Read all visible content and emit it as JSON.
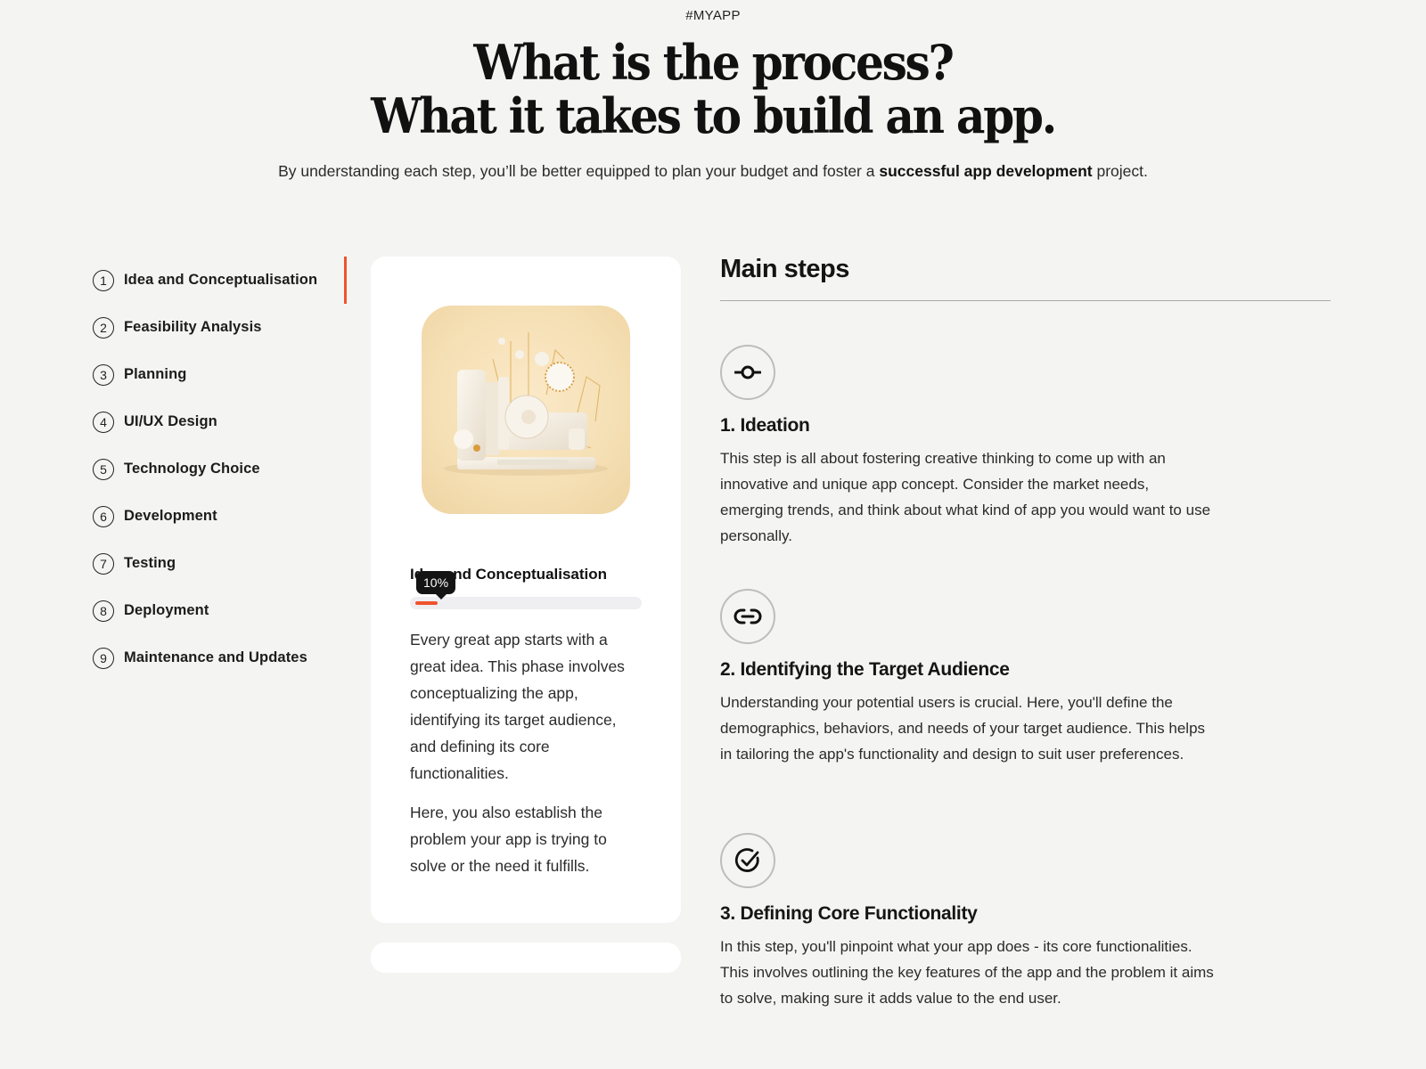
{
  "header": {
    "eyebrow": "#MYAPP",
    "title_line1": "What is the process?",
    "title_line2": "What it takes to build an app.",
    "subtitle_pre": "By understanding each step, you’ll be better equipped to plan your budget and foster a ",
    "subtitle_bold": "successful app development",
    "subtitle_post": " project."
  },
  "sidebar": {
    "active_index": 0,
    "accent_color": "#f0532d",
    "items": [
      {
        "num": "1",
        "label": "Idea and Conceptualisation"
      },
      {
        "num": "2",
        "label": "Feasibility Analysis"
      },
      {
        "num": "3",
        "label": "Planning"
      },
      {
        "num": "4",
        "label": "UI/UX Design"
      },
      {
        "num": "5",
        "label": "Technology Choice"
      },
      {
        "num": "6",
        "label": "Development"
      },
      {
        "num": "7",
        "label": "Testing"
      },
      {
        "num": "8",
        "label": "Deployment"
      },
      {
        "num": "9",
        "label": "Maintenance and Updates"
      }
    ]
  },
  "card": {
    "image_alt": "3D illustration of a retro computer with abstract shapes",
    "title": "Idea and Conceptualisation",
    "progress_percent": 10,
    "progress_label": "10%",
    "paragraph1": "Every great app starts with a great idea. This phase involves conceptualizing the app, identifying its target audience, and defining its core functionalities.",
    "paragraph2": "Here, you also establish the problem your app is trying to solve or the need it fulfills."
  },
  "main": {
    "heading": "Main steps",
    "steps": [
      {
        "icon": "commit-icon",
        "title": "1. Ideation",
        "description": "This step is all about fostering creative thinking to come up with an innovative and unique app concept. Consider the market needs, emerging trends, and think about what kind of app you would want to use personally."
      },
      {
        "icon": "link-icon",
        "title": "2. Identifying the Target Audience",
        "description": "Understanding your potential users is crucial. Here, you'll define the demographics, behaviors, and needs of your target audience. This helps in tailoring the app's functionality and design to suit user preferences."
      },
      {
        "icon": "check-circle-icon",
        "title": "3. Defining Core Functionality",
        "description": "In this step, you'll pinpoint what your app does - its core functionalities. This involves outlining the key features of the app and the problem it aims to solve, making sure it adds value to the end user."
      }
    ]
  }
}
